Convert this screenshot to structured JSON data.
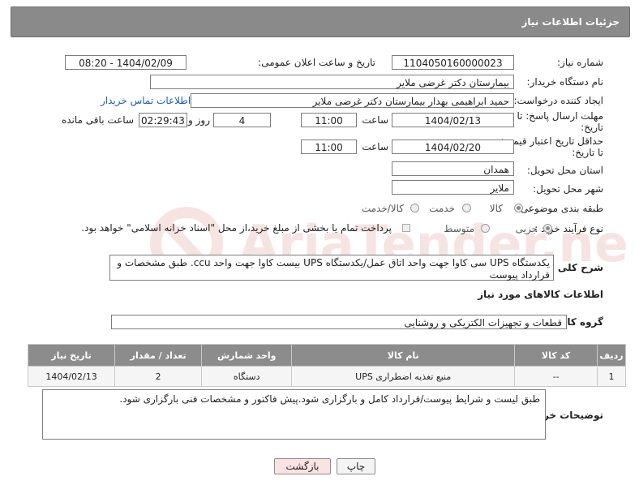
{
  "header": {
    "title": "جزئیات اطلاعات نیاز"
  },
  "form": {
    "need_number": {
      "label": "شماره نیاز:",
      "value": "1104050160000023"
    },
    "announce": {
      "label": "تاریخ و ساعت اعلان عمومی:",
      "value": "1404/02/09 - 08:20"
    },
    "buyer_org": {
      "label": "نام دستگاه خریدار:",
      "value": "بیمارستان دکتر غرضی ملایر"
    },
    "requester": {
      "label": "ایجاد کننده درخواست:",
      "value": "حمید ابراهیمی بهدار بیمارستان دکتر غرضی ملایر",
      "contact_link": "اطلاعات تماس خریدار"
    },
    "deadline": {
      "label_line1": "مهلت ارسال پاسخ: تا",
      "label_line2": "تاریخ:",
      "date": "1404/02/13",
      "time_label": "ساعت",
      "time": "11:00",
      "days": "4",
      "days_label": "روز و",
      "remaining": "02:29:43",
      "remaining_label": "ساعت باقی مانده"
    },
    "price_validity": {
      "label_line1": "حداقل تاریخ اعتبار قیمت:",
      "label_line2": "تا تاریخ:",
      "date": "1404/02/20",
      "time_label": "ساعت",
      "time": "11:00"
    },
    "province": {
      "label": "استان محل تحویل:",
      "value": "همدان"
    },
    "city": {
      "label": "شهر محل تحویل:",
      "value": "ملایر"
    },
    "category": {
      "label": "طبقه بندی موضوعی:",
      "options": [
        "کالا",
        "خدمت",
        "کالا/خدمت"
      ]
    },
    "process": {
      "label": "نوع فرآیند خرید :",
      "options": [
        "جزیی",
        "متوسط"
      ],
      "payment_note": "پرداخت تمام یا بخشی از مبلغ خرید،از محل \"اسناد خزانه اسلامی\" خواهد بود."
    },
    "description": {
      "label": "شرح کلی نیاز:",
      "value": "یکدستگاه UPS سی کاوا جهت واحد اتاق عمل/یکدستگاه UPS بیست کاوا جهت واحد ccu. طبق مشخصات و قرارداد پیوست"
    }
  },
  "goods": {
    "section_title": "اطلاعات کالاهای مورد نیاز",
    "group_label": "گروه کالا:",
    "group_value": "قطعات و تجهیزات الکتریکی و روشنایی",
    "columns": [
      "ردیف",
      "کد کالا",
      "نام کالا",
      "واحد شمارش",
      "تعداد / مقدار",
      "تاریخ نیاز"
    ],
    "rows": [
      {
        "row": "1",
        "code": "--",
        "name": "منبع تغذیه اضطراری UPS",
        "unit": "دستگاه",
        "qty": "2",
        "date": "1404/02/13"
      }
    ]
  },
  "buyer_notes": {
    "label": "توضیحات خریدار:",
    "value": "طبق لیست و شرایط پیوست/قرارداد کامل و بارگزاری شود.پیش فاکتور و مشخصات فنی بارگزاری شود."
  },
  "buttons": {
    "print": "چاپ",
    "back": "بازگشت"
  },
  "watermark": {
    "text": "AriaTender.neT"
  },
  "colors": {
    "panel": "#8a8a8a",
    "link": "#1a5fb4",
    "back_button": "#fbe3e3"
  }
}
